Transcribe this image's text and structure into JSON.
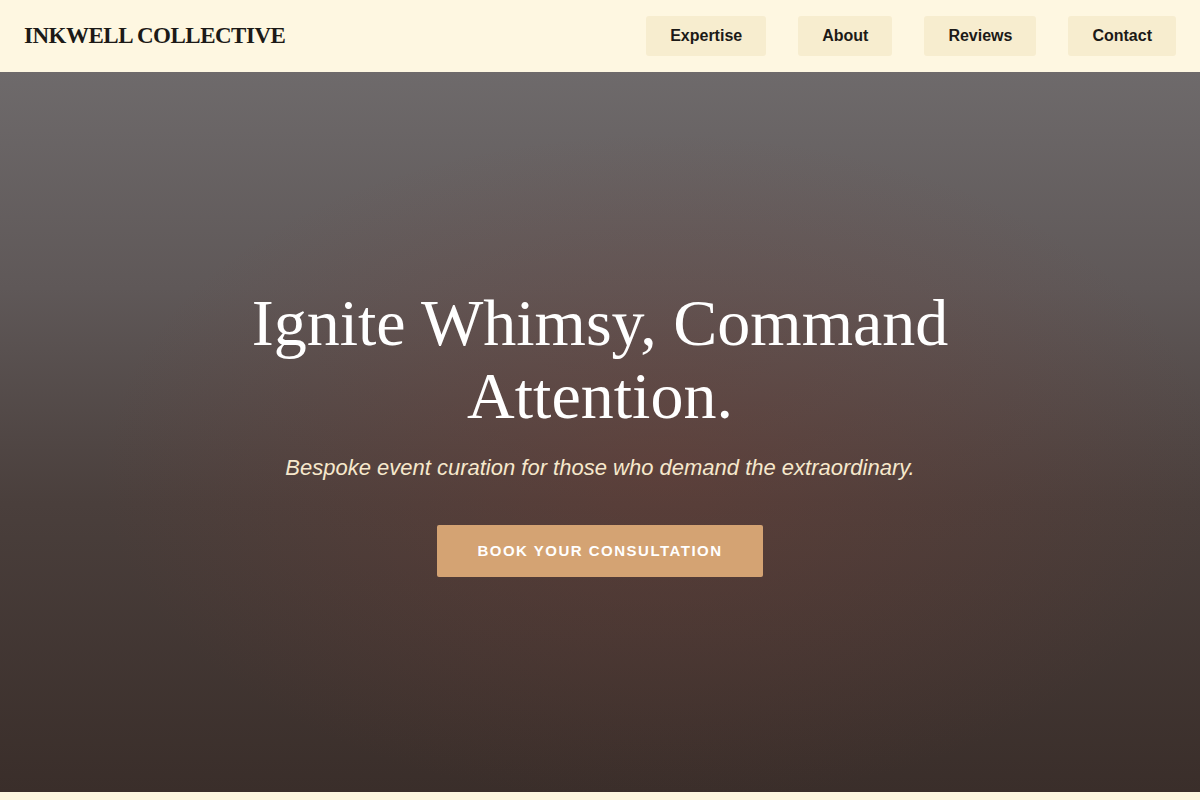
{
  "header": {
    "brand": "INKWELL COLLECTIVE",
    "nav": [
      {
        "label": "Expertise"
      },
      {
        "label": "About"
      },
      {
        "label": "Reviews"
      },
      {
        "label": "Contact"
      }
    ]
  },
  "hero": {
    "title": "Ignite Whimsy, Command Attention.",
    "subtitle": "Bespoke event curation for those who demand the extraordinary.",
    "button": "BOOK YOUR CONSULTATION"
  }
}
